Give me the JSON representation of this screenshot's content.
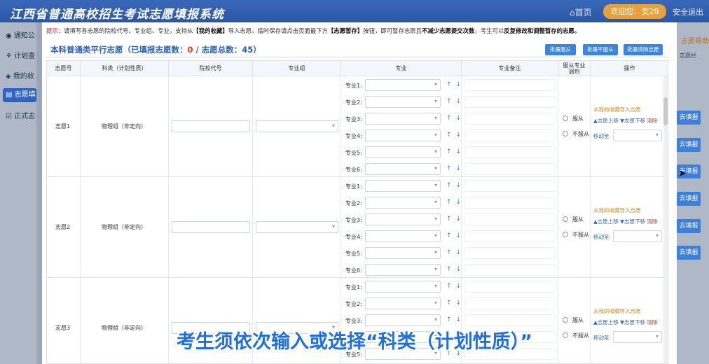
{
  "app": {
    "title": "江西省普通高校招生考试志愿填报系统",
    "home": "⌂首页",
    "welcome": "欢迎您：支28",
    "logout": "安全退出"
  },
  "sidebar": {
    "items": [
      {
        "label": "通知公",
        "icon": "bell-icon"
      },
      {
        "label": "计划查",
        "icon": "plan-icon"
      },
      {
        "label": "我的收",
        "icon": "layers-icon"
      },
      {
        "label": "志愿填",
        "icon": "form-icon",
        "active": true
      },
      {
        "label": "正式志",
        "icon": "check-icon"
      }
    ]
  },
  "rightpane": {
    "help": "志愿帮助",
    "link": "志愿栏",
    "buttons": [
      "去填报",
      "去填报",
      "去填报",
      "去填报",
      "去填报",
      "去填报"
    ]
  },
  "tip": {
    "prefix": "提示：",
    "text1": "请填写各志愿的院校代号、专业组、专业，支持从",
    "bold1": "【我的收藏】",
    "text2": "导入志愿。临时保存请点击页面最下方",
    "bold2": "【志愿暂存】",
    "text3": "按钮，即可暂存志愿且",
    "bold3": "不减少志愿提交次数",
    "text4": "，考生可以",
    "bold4": "反复修改和调整暂存的志愿。"
  },
  "section": {
    "title_prefix": "本科普通类平行志愿（已填报志愿数：",
    "filled": "0",
    "title_mid": " / 志愿总数：",
    "total": "45",
    "title_suffix": "）",
    "btn_obey": "批量服从",
    "btn_not_obey": "批量不服从",
    "btn_clear": "批量清除志愿"
  },
  "columns": {
    "no": "志愿号",
    "category": "科类（计划性质）",
    "school_code": "院校代号",
    "group": "专业组",
    "major": "专业",
    "remark": "专业备注",
    "adjust": "服从专业调剂",
    "action": "操作"
  },
  "rows": [
    {
      "no": "志愿1",
      "category": "物理组（非定向）"
    },
    {
      "no": "志愿2",
      "category": "物理组（非定向）"
    },
    {
      "no": "志愿3",
      "category": "物理组（非定向）"
    }
  ],
  "major_labels": [
    "专业1:",
    "专业2:",
    "专业3:",
    "专业4:",
    "专业5:",
    "专业6:"
  ],
  "row_ops": {
    "import": "从我的收藏导入志愿",
    "up": "▲志愿上移",
    "down": "▼志愿下移",
    "clear": "清除",
    "move_to": "移动至",
    "obey": "服从",
    "not_obey": "不服从"
  },
  "caption": "考生须依次输入或选择“科类（计划性质）”"
}
